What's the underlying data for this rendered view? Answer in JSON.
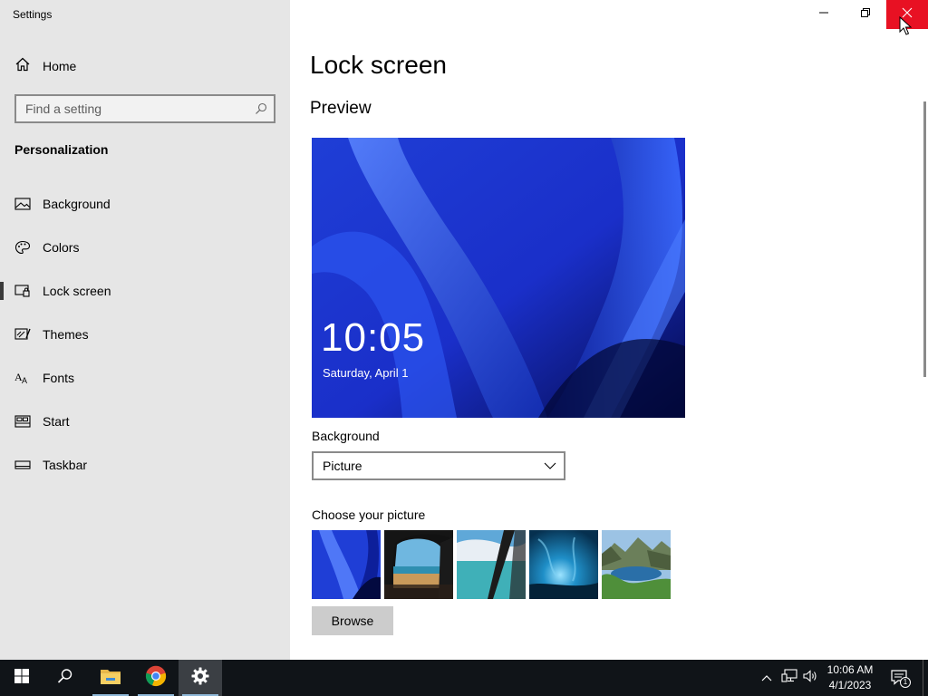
{
  "window": {
    "app_title": "Settings",
    "controls": {
      "minimize_icon": "minimize-icon",
      "maximize_icon": "restore-icon",
      "close_icon": "close-icon"
    },
    "close_color": "#e81123"
  },
  "sidebar": {
    "home_label": "Home",
    "search": {
      "placeholder": "Find a setting",
      "value": ""
    },
    "section_heading": "Personalization",
    "items": [
      {
        "label": "Background",
        "icon": "image-icon",
        "active": false
      },
      {
        "label": "Colors",
        "icon": "palette-icon",
        "active": false
      },
      {
        "label": "Lock screen",
        "icon": "lock-screen-icon",
        "active": true
      },
      {
        "label": "Themes",
        "icon": "themes-icon",
        "active": false
      },
      {
        "label": "Fonts",
        "icon": "fonts-icon",
        "active": false
      },
      {
        "label": "Start",
        "icon": "start-icon",
        "active": false
      },
      {
        "label": "Taskbar",
        "icon": "taskbar-icon",
        "active": false
      }
    ]
  },
  "main": {
    "page_title": "Lock screen",
    "preview_label": "Preview",
    "preview": {
      "time": "10:05",
      "date": "Saturday, April 1"
    },
    "background_label": "Background",
    "background_value": "Picture",
    "choose_label": "Choose your picture",
    "pictures": [
      "blue-swirl-wallpaper",
      "cave-beach-wallpaper",
      "window-sea-wallpaper",
      "underwater-wallpaper",
      "mountain-lake-wallpaper"
    ],
    "browse_label": "Browse"
  },
  "taskbar": {
    "apps": [
      "start-icon",
      "search-icon",
      "file-explorer-icon",
      "chrome-icon",
      "settings-icon"
    ],
    "clock": {
      "time": "10:06 AM",
      "date": "4/1/2023"
    },
    "notification_count": "1",
    "accent": "#8fb8d8"
  }
}
